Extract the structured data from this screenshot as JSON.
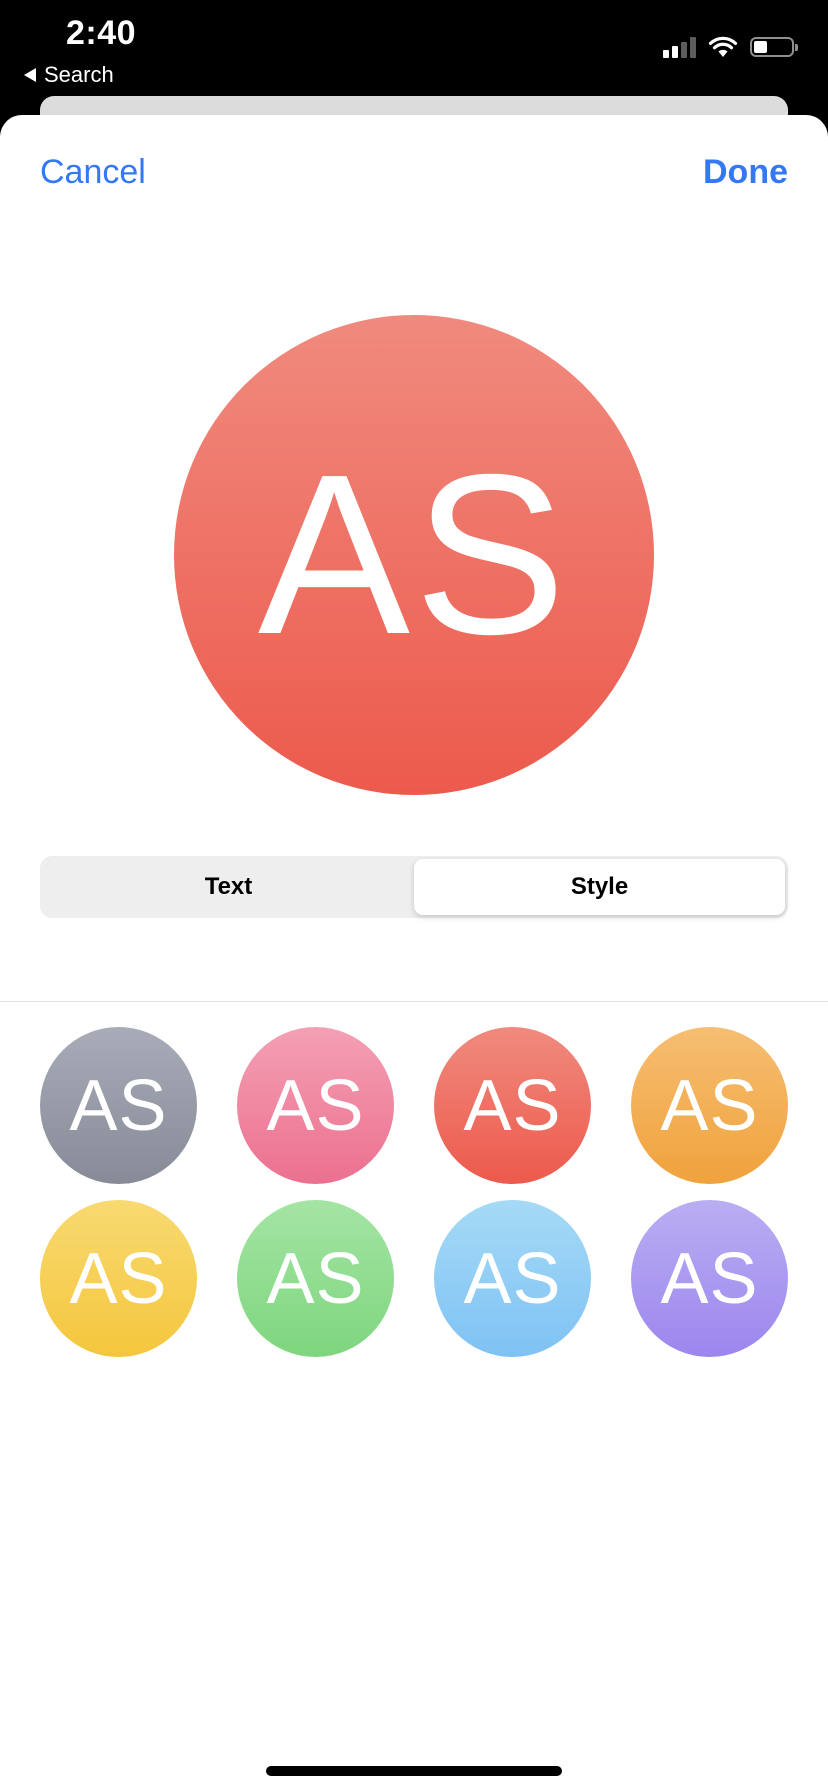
{
  "status_bar": {
    "time": "2:40",
    "back_label": "Search",
    "battery_level": 0.35
  },
  "nav": {
    "cancel_label": "Cancel",
    "done_label": "Done"
  },
  "preview": {
    "initials": "AS",
    "gradient": [
      "#f08a7e",
      "#ec5a4c"
    ]
  },
  "segmented_control": {
    "options": [
      "Text",
      "Style"
    ],
    "selected": "Style"
  },
  "styles": [
    {
      "initials": "AS",
      "gradient": [
        "#a8acb8",
        "#868b97"
      ]
    },
    {
      "initials": "AS",
      "gradient": [
        "#f4a0b4",
        "#ec7090"
      ]
    },
    {
      "initials": "AS",
      "gradient": [
        "#f08a7e",
        "#ec5a4c"
      ]
    },
    {
      "initials": "AS",
      "gradient": [
        "#f6be72",
        "#f0a23c"
      ]
    },
    {
      "initials": "AS",
      "gradient": [
        "#f8da72",
        "#f4c63c"
      ]
    },
    {
      "initials": "AS",
      "gradient": [
        "#a4e4a4",
        "#7ed67e"
      ]
    },
    {
      "initials": "AS",
      "gradient": [
        "#a6daf6",
        "#7ec2f4"
      ]
    },
    {
      "initials": "AS",
      "gradient": [
        "#baaef2",
        "#9c86ee"
      ]
    }
  ],
  "colors": {
    "accent": "#3478f6"
  }
}
